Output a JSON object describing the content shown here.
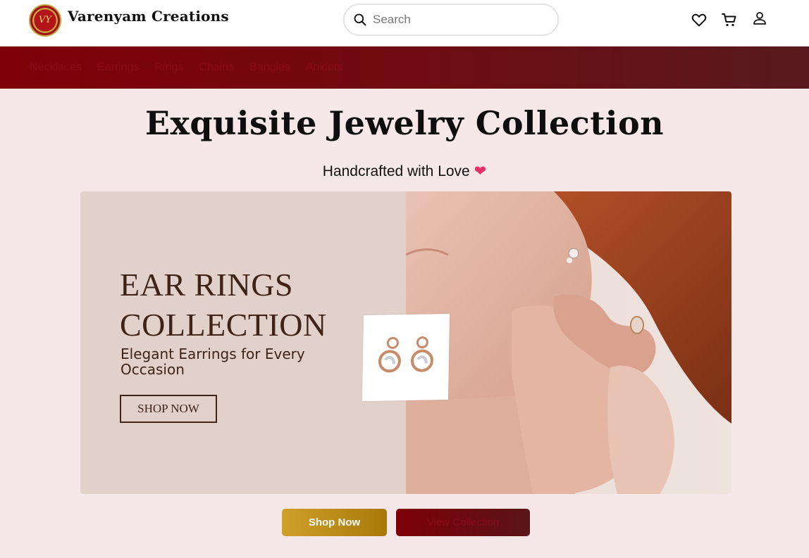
{
  "header": {
    "logo_text": "VY",
    "brand": "Varenyam Creations",
    "search": {
      "placeholder": "Search"
    },
    "icons": [
      "heart-icon",
      "cart-icon",
      "user-icon"
    ]
  },
  "nav": {
    "items": [
      "Necklaces",
      "Earrings",
      "Rings",
      "Chains",
      "Bangles",
      "Anklets"
    ]
  },
  "hero": {
    "title": "Exquisite Jewelry Collection",
    "subtitle": "Handcrafted with Love",
    "subtitle_emoji": "❤"
  },
  "banner": {
    "heading_line1": "EAR RINGS",
    "heading_line2": "COLLECTION",
    "tagline": "Elegant Earrings for Every Occasion",
    "button": "SHOP NOW"
  },
  "actions": {
    "shop_now": "Shop Now",
    "view_collection": "View Collection"
  },
  "colors": {
    "nav_start": "#800008",
    "nav_end": "#581a1e",
    "page_bg": "#f6e8e9",
    "gold_button": "#c4931f",
    "banner_text": "#3d2318"
  }
}
